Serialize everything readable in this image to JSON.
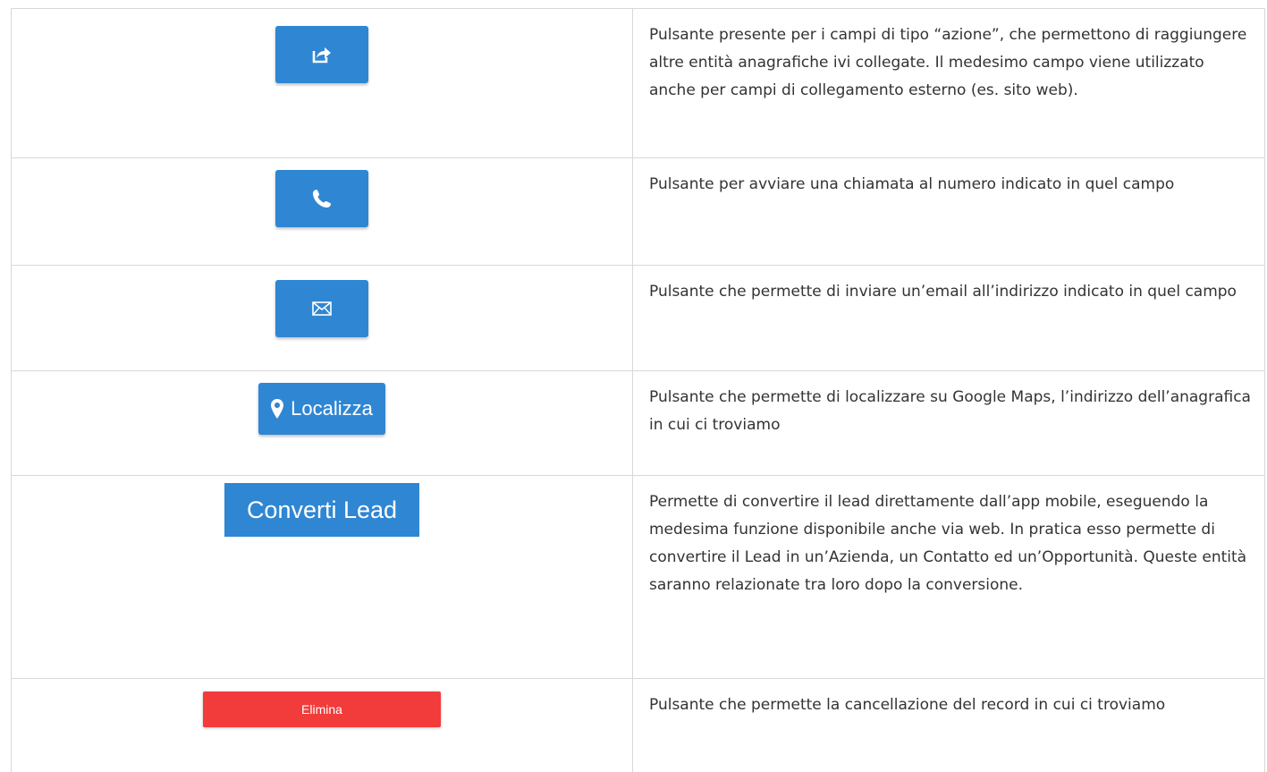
{
  "rows": [
    {
      "icon": "share-icon",
      "description": "Pulsante presente per i campi di tipo “azione”, che permettono di raggiungere altre entità anagrafiche ivi collegate. Il medesimo campo viene utilizzato anche per campi di collegamento esterno (es. sito web)."
    },
    {
      "icon": "phone-icon",
      "description": "Pulsante per avviare una chiamata al numero indicato in quel campo"
    },
    {
      "icon": "envelope-icon",
      "description": "Pulsante che permette di inviare un’email all’indirizzo indicato in quel campo"
    },
    {
      "icon": "map-marker-icon",
      "button_label": "Localizza",
      "description": "Pulsante che permette di localizzare su Google Maps, l’indirizzo dell’anagrafica in cui ci troviamo"
    },
    {
      "button_label": "Converti Lead",
      "description": "Permette di convertire il lead direttamente dall’app mobile, eseguendo la medesima funzione disponibile anche via web. In pratica esso permette di convertire il Lead in un’Azienda, un Contatto ed un’Opportunità. Queste entità saranno relazionate tra loro dopo la conversione."
    },
    {
      "button_label": "Elimina",
      "description": "Pulsante che permette la cancellazione del record in cui ci troviamo"
    }
  ],
  "colors": {
    "primary_button": "#2f86d3",
    "danger_button": "#f23b3b",
    "border": "#d8d8d8",
    "text": "#333333"
  }
}
